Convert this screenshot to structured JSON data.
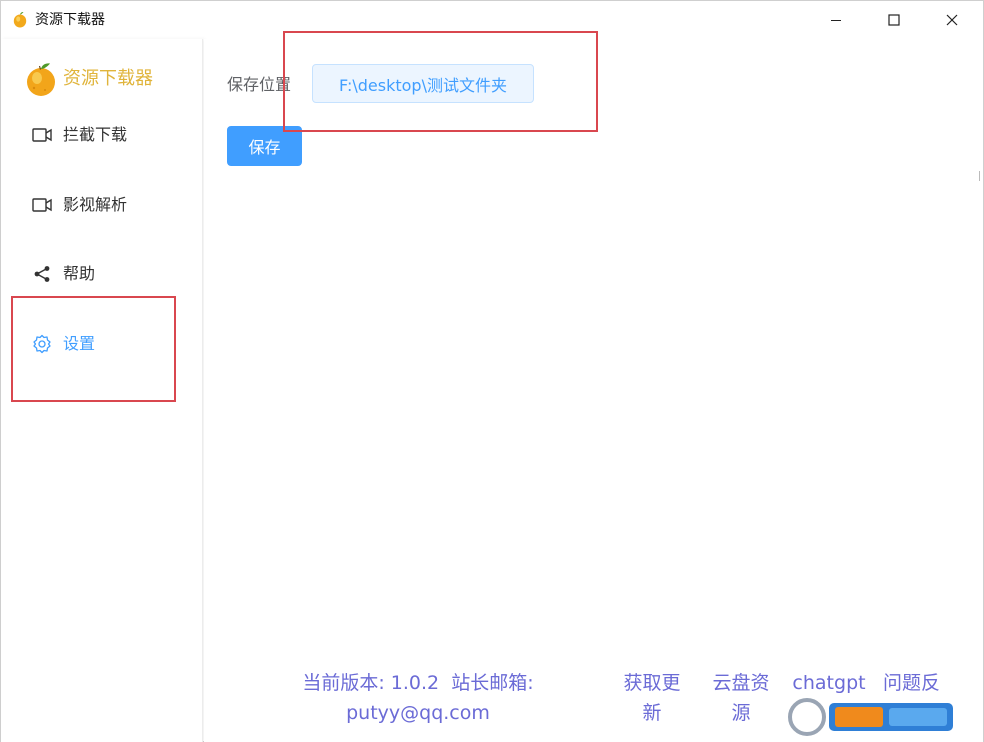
{
  "window": {
    "title": "资源下载器",
    "controls": {
      "minimize": "minimize",
      "maximize": "maximize",
      "close": "close"
    }
  },
  "sidebar": {
    "brand": "资源下载器",
    "items": [
      {
        "label": "拦截下载",
        "icon": "video-camera-icon"
      },
      {
        "label": "影视解析",
        "icon": "video-camera-icon"
      },
      {
        "label": "帮助",
        "icon": "share-icon"
      },
      {
        "label": "设置",
        "icon": "gear-icon",
        "active": true
      }
    ]
  },
  "main": {
    "save_location_label": "保存位置",
    "save_path": "F:\\desktop\\测试文件夹",
    "save_button": "保存"
  },
  "footer": {
    "version_line1": "当前版本: 1.0.2  站长邮箱:",
    "version_line2": "putyy@qq.com",
    "update_line1": "获取更",
    "update_line2": "新",
    "cloud_line1": "云盘资",
    "cloud_line2": "源",
    "chatgpt": "chatgpt",
    "feedback_line1": "问题反"
  },
  "colors": {
    "accent": "#409eff",
    "brand": "#e0b43b",
    "footer_link": "#6b6bd6",
    "highlight": "#d9474f"
  }
}
